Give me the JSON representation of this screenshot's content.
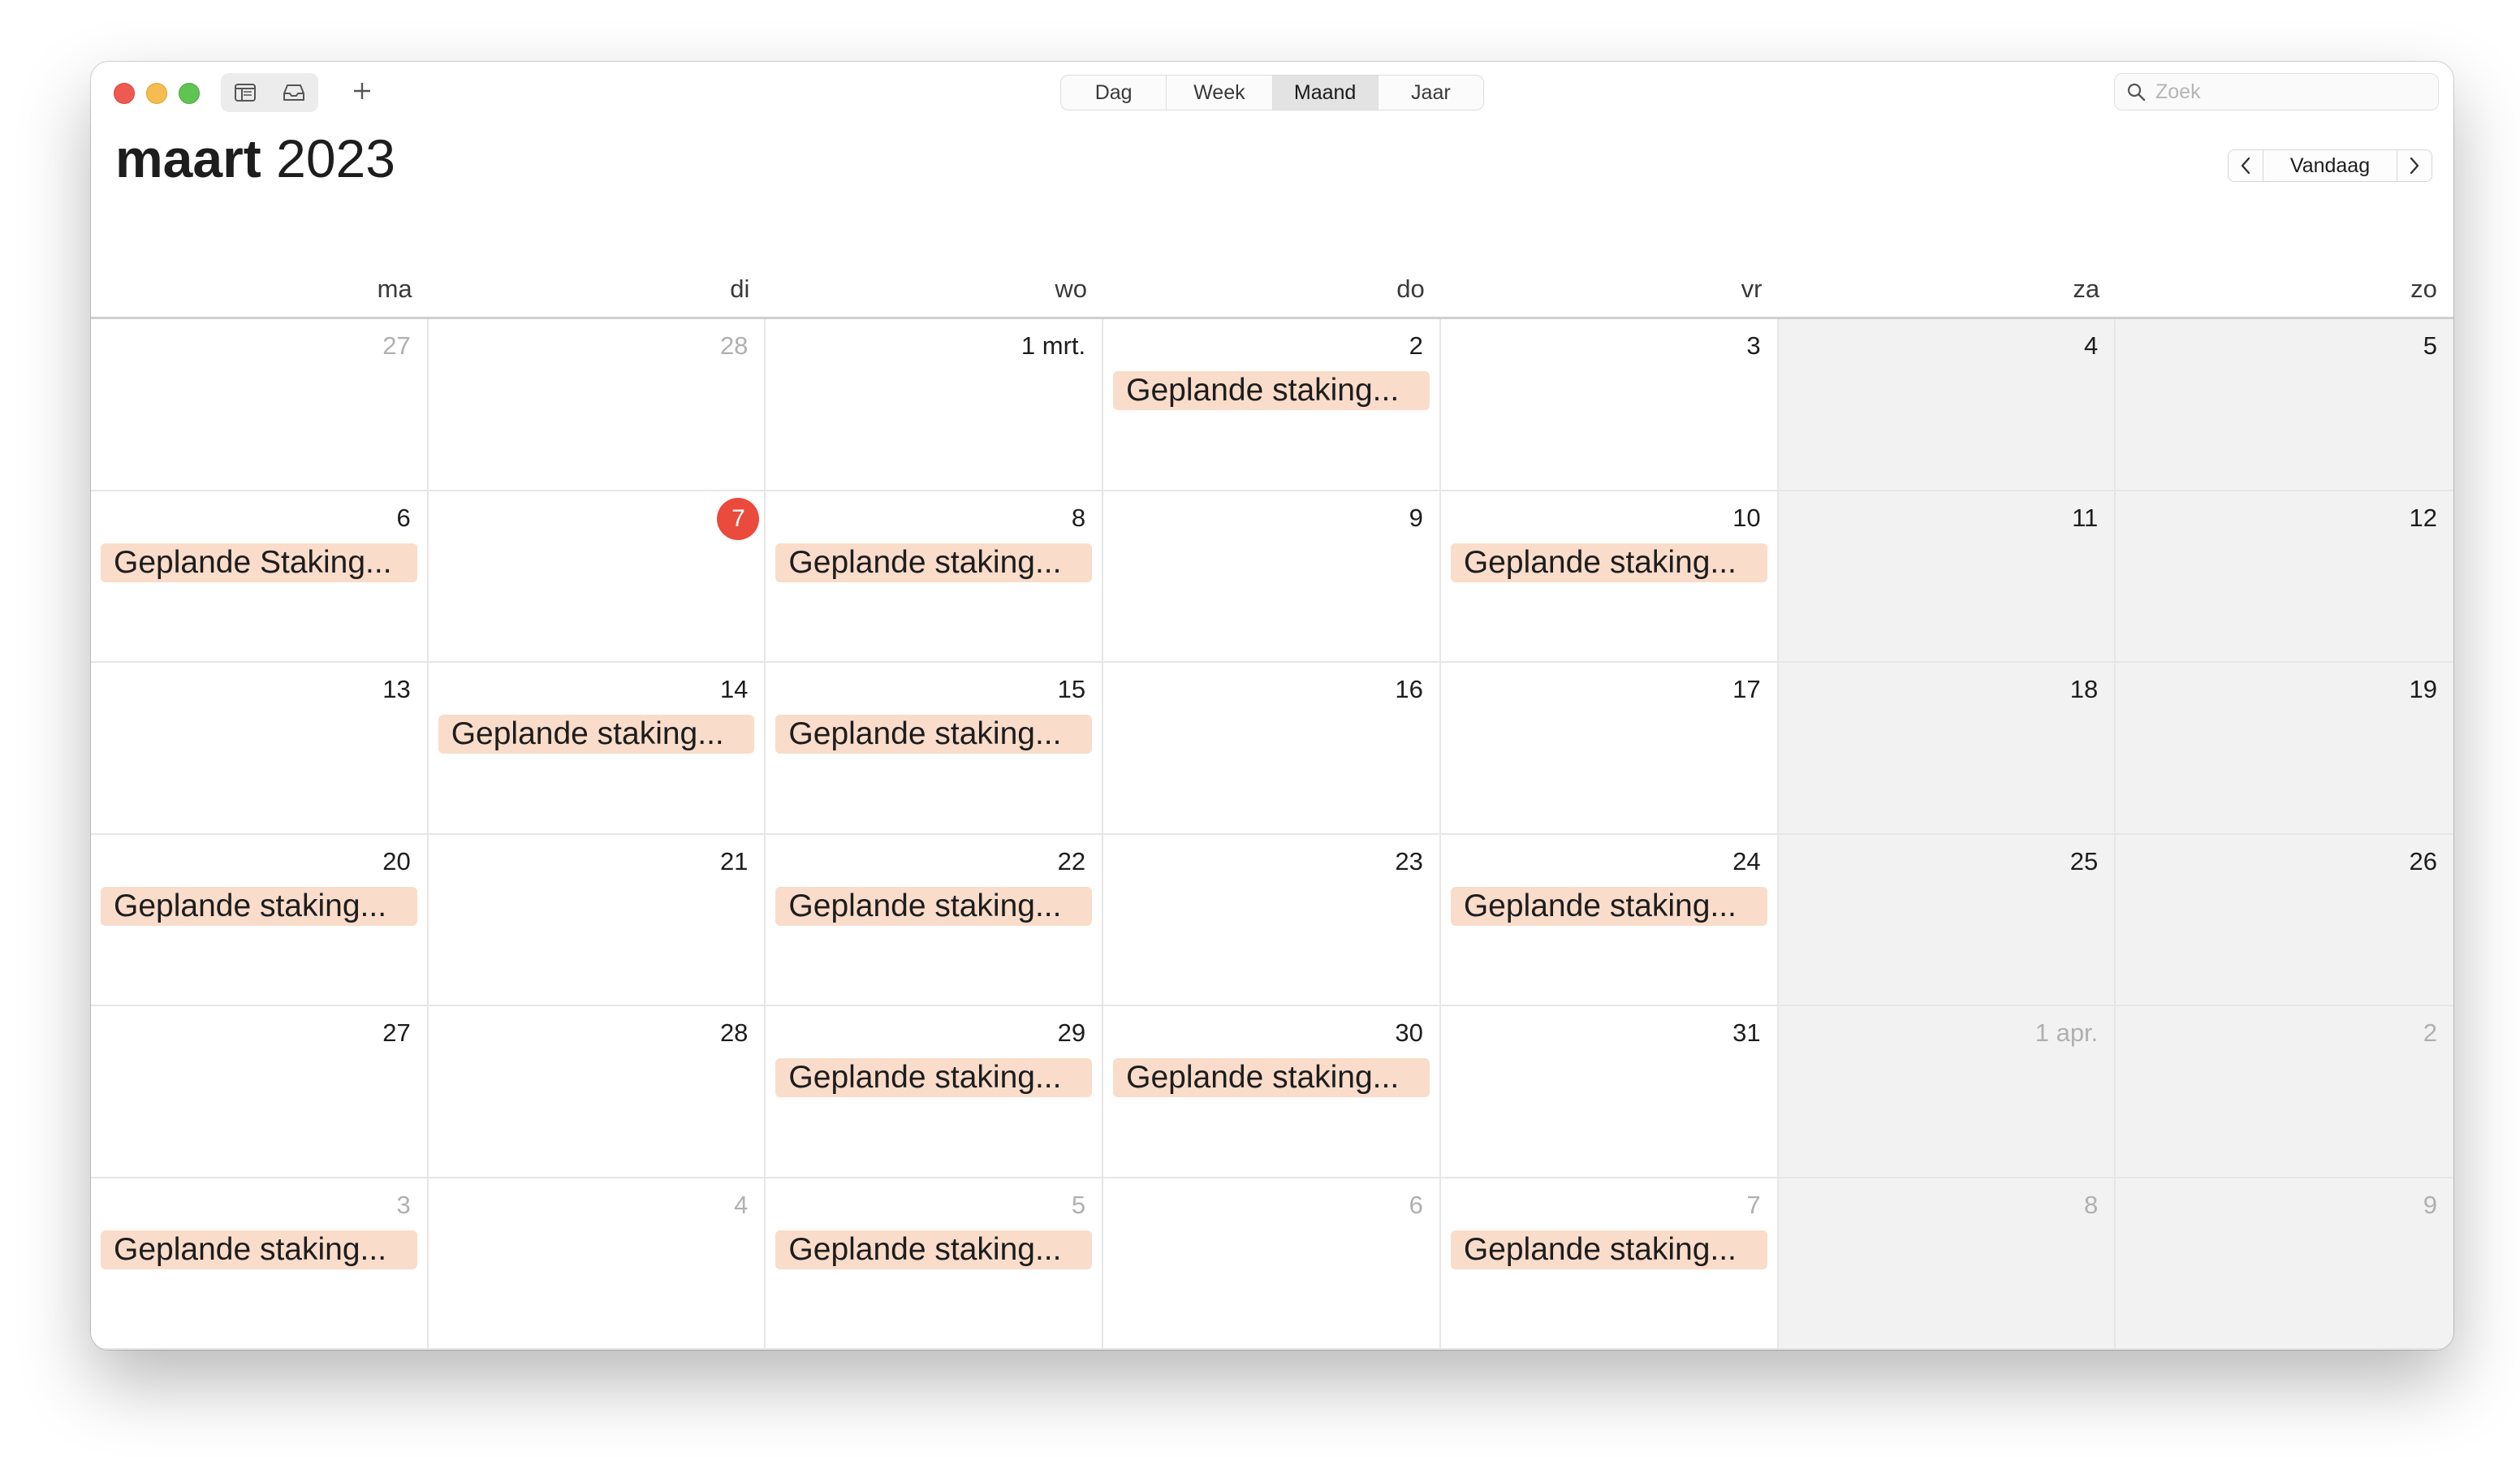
{
  "toolbar": {
    "views": [
      {
        "label": "Dag",
        "active": false
      },
      {
        "label": "Week",
        "active": false
      },
      {
        "label": "Maand",
        "active": true
      },
      {
        "label": "Jaar",
        "active": false
      }
    ],
    "search_placeholder": "Zoek"
  },
  "header": {
    "month": "maart",
    "year": "2023",
    "today_label": "Vandaag"
  },
  "weekdays": [
    "ma",
    "di",
    "wo",
    "do",
    "vr",
    "za",
    "zo"
  ],
  "colors": {
    "today": "#ea4b3c",
    "event_bg": "#fadcca",
    "weekend_bg": "#f2f2f2"
  },
  "days": [
    {
      "label": "27",
      "dim": true
    },
    {
      "label": "28",
      "dim": true
    },
    {
      "label": "1 mrt."
    },
    {
      "label": "2",
      "event": "Geplande staking..."
    },
    {
      "label": "3"
    },
    {
      "label": "4",
      "weekend": true
    },
    {
      "label": "5",
      "weekend": true
    },
    {
      "label": "6",
      "event": "Geplande Staking..."
    },
    {
      "label": "7",
      "today": true
    },
    {
      "label": "8",
      "event": "Geplande staking..."
    },
    {
      "label": "9"
    },
    {
      "label": "10",
      "event": "Geplande staking..."
    },
    {
      "label": "11",
      "weekend": true
    },
    {
      "label": "12",
      "weekend": true
    },
    {
      "label": "13"
    },
    {
      "label": "14",
      "event": "Geplande staking..."
    },
    {
      "label": "15",
      "event": "Geplande staking..."
    },
    {
      "label": "16"
    },
    {
      "label": "17"
    },
    {
      "label": "18",
      "weekend": true
    },
    {
      "label": "19",
      "weekend": true
    },
    {
      "label": "20",
      "event": "Geplande staking..."
    },
    {
      "label": "21"
    },
    {
      "label": "22",
      "event": "Geplande staking..."
    },
    {
      "label": "23"
    },
    {
      "label": "24",
      "event": "Geplande staking..."
    },
    {
      "label": "25",
      "weekend": true
    },
    {
      "label": "26",
      "weekend": true
    },
    {
      "label": "27"
    },
    {
      "label": "28"
    },
    {
      "label": "29",
      "event": "Geplande staking..."
    },
    {
      "label": "30",
      "event": "Geplande staking..."
    },
    {
      "label": "31"
    },
    {
      "label": "1 apr.",
      "dim": true,
      "weekend": true
    },
    {
      "label": "2",
      "dim": true,
      "weekend": true
    },
    {
      "label": "3",
      "dim": true,
      "event": "Geplande staking..."
    },
    {
      "label": "4",
      "dim": true
    },
    {
      "label": "5",
      "dim": true,
      "event": "Geplande staking..."
    },
    {
      "label": "6",
      "dim": true
    },
    {
      "label": "7",
      "dim": true,
      "event": "Geplande staking..."
    },
    {
      "label": "8",
      "dim": true,
      "weekend": true
    },
    {
      "label": "9",
      "dim": true,
      "weekend": true
    }
  ]
}
